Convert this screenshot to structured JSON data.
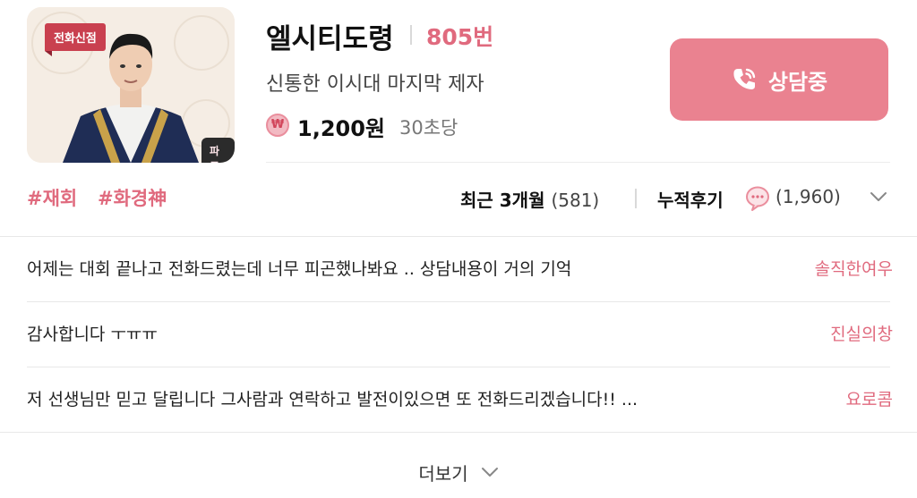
{
  "counselor": {
    "badge": "전화신점",
    "partner_badge": "파트너",
    "name": "엘시티도령",
    "number": "805번",
    "description": "신통한 이시대 마지막 제자",
    "price_icon": "₩",
    "price": "1,200원",
    "per": "30초당",
    "cta_label": "상담중",
    "tags": [
      "#재회",
      "#화경神"
    ],
    "recent_label": "최근 3개월",
    "recent_count": "(581)",
    "reviews_label": "누적후기",
    "reviews_count": "(1,960)"
  },
  "reviews": [
    {
      "text": "어제는 대회 끝나고 전화드렸는데 너무 피곤했나봐요 .. 상담내용이 거의 기억",
      "author": "솔직한여우"
    },
    {
      "text": "감사합니다 ㅜㅠㅠ",
      "author": "진실의창"
    },
    {
      "text": "저 선생님만 믿고 달립니다 그사람과 연락하고 발전이있으면 또 전화드리겠습니다!! ...",
      "author": "요로콤"
    }
  ],
  "more_label": "더보기",
  "colors": {
    "accent": "#e06a7e",
    "cta": "#ea8290",
    "ribbon": "#c9404f"
  }
}
